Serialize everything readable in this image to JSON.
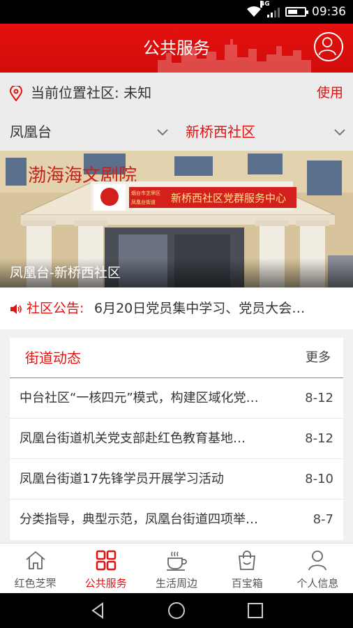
{
  "status_bar": {
    "time": "09:36",
    "network": "4G",
    "battery_level": 0.6
  },
  "header": {
    "title": "公共服务"
  },
  "location": {
    "label": "当前位置社区: 未知",
    "action": "使用"
  },
  "selectors": {
    "street": "凤凰台",
    "community": "新桥西社区"
  },
  "banner": {
    "caption": "凤凰台-新桥西社区",
    "sign_text": "新桥西社区党群服务中心",
    "sign_small_1": "烟台市芝罘区",
    "sign_small_2": "凤凰台街道",
    "roof_text": "渤海海文剧院"
  },
  "notice": {
    "label": "社区公告:",
    "text": "6月20日党员集中学习、党员大会…"
  },
  "news": {
    "title": "街道动态",
    "more": "更多",
    "items": [
      {
        "headline": "中台社区“一核四元”模式，构建区域化党…",
        "date": "8-12"
      },
      {
        "headline": "凤凰台街道机关党支部赴红色教育基地…",
        "date": "8-12"
      },
      {
        "headline": "凤凰台街道17先锋学员开展学习活动",
        "date": "8-10"
      },
      {
        "headline": "分类指导，典型示范，凤凰台街道四项举…",
        "date": "8-7"
      }
    ]
  },
  "tabs": [
    {
      "label": "红色芝罘",
      "icon": "home-icon",
      "active": false
    },
    {
      "label": "公共服务",
      "icon": "grid-icon",
      "active": true
    },
    {
      "label": "生活周边",
      "icon": "coffee-icon",
      "active": false
    },
    {
      "label": "百宝箱",
      "icon": "bag-icon",
      "active": false
    },
    {
      "label": "个人信息",
      "icon": "person-icon",
      "active": false
    }
  ],
  "colors": {
    "brand_red": "#e3110f",
    "background": "#f1f1f1"
  }
}
